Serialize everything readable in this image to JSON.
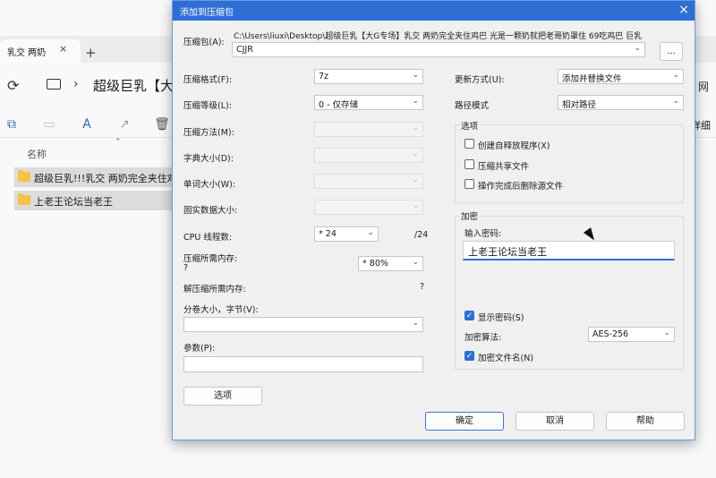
{
  "explorer": {
    "tab_label": "乳交 两奶",
    "tab_close": "×",
    "new_tab": "+",
    "address_path": "超级巨乳【大G专",
    "right_clipped": "网",
    "details_label": "详细",
    "column_name": "名称",
    "rows": [
      "超级巨乳!!!乳交 两奶完全夹住鸡巴",
      "上老王论坛当老王"
    ]
  },
  "dialog": {
    "title": "添加到压缩包",
    "close": "×",
    "archive": {
      "label": "压缩包(A):",
      "path": "C:\\Users\\liuxi\\Desktop\\超级巨乳【大G专场】乳交 两奶完全夹住鸡巴 光是一颗奶就把老哥奶罩住 69吃鸡巴 巨乳",
      "value": "CJJR",
      "browse": "..."
    },
    "left": {
      "format_label": "压缩格式(F):",
      "format_value": "7z",
      "level_label": "压缩等级(L):",
      "level_value": "0 - 仅存储",
      "method_label": "压缩方法(M):",
      "dict_label": "字典大小(D):",
      "word_label": "单词大小(W):",
      "solid_label": "固实数据大小:",
      "cpu_label": "CPU 线程数:",
      "cpu_value": "* 24",
      "cpu_total": "/24",
      "mem_label": "压缩所需内存:",
      "mem_q": "?",
      "mem_value": "* 80%",
      "decomp_label": "解压缩所需内存:",
      "decomp_q": "?",
      "split_label": "分卷大小，字节(V):",
      "params_label": "参数(P):",
      "options_btn": "选项"
    },
    "right": {
      "update_label": "更新方式(U):",
      "update_value": "添加并替换文件",
      "pathmode_label": "路径模式",
      "pathmode_value": "相对路径",
      "options_title": "选项",
      "opt_sfx": "创建自释放程序(X)",
      "opt_shared": "压缩共享文件",
      "opt_delete": "操作完成后删除源文件",
      "enc_title": "加密",
      "enc_prompt": "输入密码:",
      "password": "上老王论坛当老王",
      "show_pw": "显示密码(S)",
      "enc_method_label": "加密算法:",
      "enc_method_value": "AES-256",
      "enc_names": "加密文件名(N)"
    },
    "buttons": {
      "ok": "确定",
      "cancel": "取消",
      "help": "帮助"
    }
  }
}
